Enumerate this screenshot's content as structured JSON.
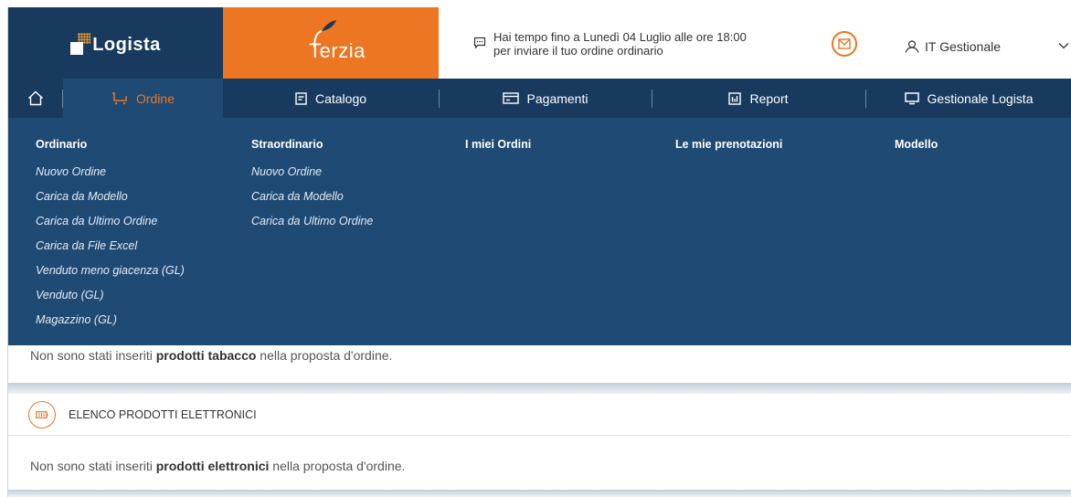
{
  "brand": {
    "logista": "Logista",
    "terzia": "Terzia"
  },
  "notice": {
    "line1": "Hai tempo fino a Lunedì 04 Luglio alle ore 18:00",
    "line2": "per inviare il tuo ordine ordinario"
  },
  "user": {
    "name": "IT Gestionale"
  },
  "nav": {
    "items": [
      {
        "label": "Ordine",
        "icon": "cart-icon",
        "active": true
      },
      {
        "label": "Catalogo",
        "icon": "document-icon",
        "active": false
      },
      {
        "label": "Pagamenti",
        "icon": "card-icon",
        "active": false
      },
      {
        "label": "Report",
        "icon": "chart-icon",
        "active": false
      },
      {
        "label": "Gestionale Logista",
        "icon": "monitor-icon",
        "active": false
      }
    ]
  },
  "menu": {
    "ordinario": {
      "title": "Ordinario",
      "links": [
        "Nuovo Ordine",
        "Carica da Modello",
        "Carica da Ultimo Ordine",
        "Carica da File Excel",
        "Venduto meno giacenza (GL)",
        "Venduto (GL)",
        "Magazzino (GL)"
      ]
    },
    "straordinario": {
      "title": "Straordinario",
      "links": [
        "Nuovo Ordine",
        "Carica da Modello",
        "Carica da Ultimo Ordine"
      ]
    },
    "miei_ordini": {
      "title": "I miei Ordini"
    },
    "prenotazioni": {
      "title": "Le mie prenotazioni"
    },
    "modello": {
      "title": "Modello"
    }
  },
  "content": {
    "tabacco": {
      "pre": "Non sono stati inseriti ",
      "bold": "prodotti tabacco",
      "post": " nella proposta d'ordine."
    },
    "section_title": "ELENCO PRODOTTI ELETTRONICI",
    "elettronici": {
      "pre": "Non sono stati inseriti ",
      "bold": "prodotti elettronici",
      "post": " nella proposta d'ordine."
    }
  },
  "colors": {
    "navy": "#173a5e",
    "menu_blue": "#1f4a74",
    "orange": "#ec7622"
  }
}
